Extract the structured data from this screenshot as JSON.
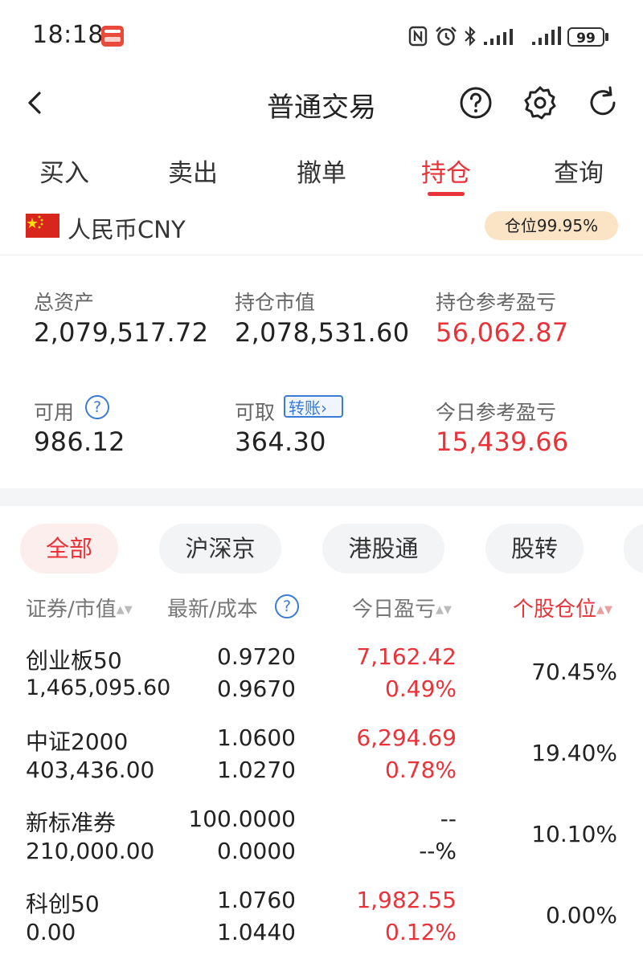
{
  "status_bar": {
    "time": "18:18",
    "battery": "99"
  },
  "nav": {
    "title": "普通交易"
  },
  "tabs": [
    {
      "label": "买入"
    },
    {
      "label": "卖出"
    },
    {
      "label": "撤单"
    },
    {
      "label": "持仓",
      "active": true
    },
    {
      "label": "查询"
    }
  ],
  "currency": {
    "label": "人民币CNY",
    "position_badge": "仓位99.95%"
  },
  "summary": {
    "total_assets_label": "总资产",
    "total_assets": "2,079,517.72",
    "market_value_label": "持仓市值",
    "market_value": "2,078,531.60",
    "position_pnl_label": "持仓参考盈亏",
    "position_pnl": "56,062.87",
    "available_label": "可用",
    "available": "986.12",
    "withdrawable_label": "可取",
    "withdrawable": "364.30",
    "transfer_label": "转账",
    "today_pnl_label": "今日参考盈亏",
    "today_pnl": "15,439.66"
  },
  "filters": [
    {
      "label": "全部",
      "active": true
    },
    {
      "label": "沪深京"
    },
    {
      "label": "港股通"
    },
    {
      "label": "股转"
    }
  ],
  "table": {
    "headers": {
      "security": "证券/市值",
      "price": "最新/成本",
      "today_pnl": "今日盈亏",
      "weight": "个股仓位"
    },
    "rows": [
      {
        "name": "创业板50",
        "market_value": "1,465,095.60",
        "latest": "0.9720",
        "cost": "0.9670",
        "pnl": "7,162.42",
        "pnl_pct": "0.49%",
        "weight": "70.45%"
      },
      {
        "name": "中证2000",
        "market_value": "403,436.00",
        "latest": "1.0600",
        "cost": "1.0270",
        "pnl": "6,294.69",
        "pnl_pct": "0.78%",
        "weight": "19.40%"
      },
      {
        "name": "新标准券",
        "market_value": "210,000.00",
        "latest": "100.0000",
        "cost": "0.0000",
        "pnl": "--",
        "pnl_pct": "--%",
        "weight": "10.10%"
      },
      {
        "name": "科创50",
        "market_value": "0.00",
        "latest": "1.0760",
        "cost": "1.0440",
        "pnl": "1,982.55",
        "pnl_pct": "0.12%",
        "weight": "0.00%"
      }
    ]
  },
  "colors": {
    "accent_red": "#e8333a",
    "link_blue": "#3a7bd5",
    "badge_orange": "#fbe3c6"
  }
}
